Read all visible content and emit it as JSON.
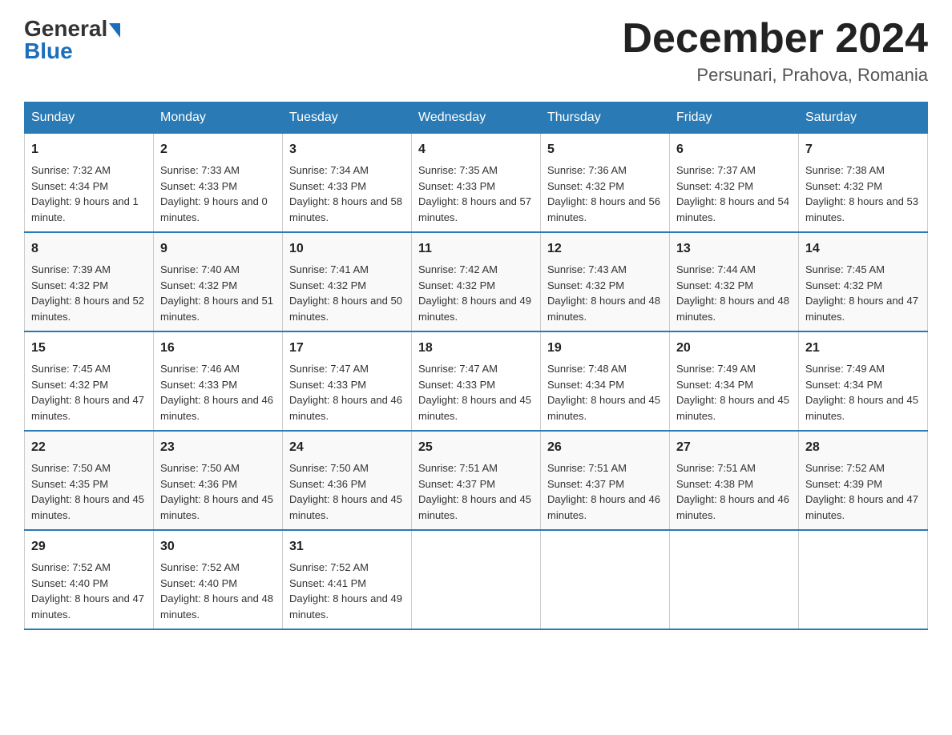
{
  "header": {
    "logo_general": "General",
    "logo_blue": "Blue",
    "month_title": "December 2024",
    "location": "Persunari, Prahova, Romania"
  },
  "days_of_week": [
    "Sunday",
    "Monday",
    "Tuesday",
    "Wednesday",
    "Thursday",
    "Friday",
    "Saturday"
  ],
  "weeks": [
    [
      {
        "day": "1",
        "sunrise": "7:32 AM",
        "sunset": "4:34 PM",
        "daylight": "9 hours and 1 minute."
      },
      {
        "day": "2",
        "sunrise": "7:33 AM",
        "sunset": "4:33 PM",
        "daylight": "9 hours and 0 minutes."
      },
      {
        "day": "3",
        "sunrise": "7:34 AM",
        "sunset": "4:33 PM",
        "daylight": "8 hours and 58 minutes."
      },
      {
        "day": "4",
        "sunrise": "7:35 AM",
        "sunset": "4:33 PM",
        "daylight": "8 hours and 57 minutes."
      },
      {
        "day": "5",
        "sunrise": "7:36 AM",
        "sunset": "4:32 PM",
        "daylight": "8 hours and 56 minutes."
      },
      {
        "day": "6",
        "sunrise": "7:37 AM",
        "sunset": "4:32 PM",
        "daylight": "8 hours and 54 minutes."
      },
      {
        "day": "7",
        "sunrise": "7:38 AM",
        "sunset": "4:32 PM",
        "daylight": "8 hours and 53 minutes."
      }
    ],
    [
      {
        "day": "8",
        "sunrise": "7:39 AM",
        "sunset": "4:32 PM",
        "daylight": "8 hours and 52 minutes."
      },
      {
        "day": "9",
        "sunrise": "7:40 AM",
        "sunset": "4:32 PM",
        "daylight": "8 hours and 51 minutes."
      },
      {
        "day": "10",
        "sunrise": "7:41 AM",
        "sunset": "4:32 PM",
        "daylight": "8 hours and 50 minutes."
      },
      {
        "day": "11",
        "sunrise": "7:42 AM",
        "sunset": "4:32 PM",
        "daylight": "8 hours and 49 minutes."
      },
      {
        "day": "12",
        "sunrise": "7:43 AM",
        "sunset": "4:32 PM",
        "daylight": "8 hours and 48 minutes."
      },
      {
        "day": "13",
        "sunrise": "7:44 AM",
        "sunset": "4:32 PM",
        "daylight": "8 hours and 48 minutes."
      },
      {
        "day": "14",
        "sunrise": "7:45 AM",
        "sunset": "4:32 PM",
        "daylight": "8 hours and 47 minutes."
      }
    ],
    [
      {
        "day": "15",
        "sunrise": "7:45 AM",
        "sunset": "4:32 PM",
        "daylight": "8 hours and 47 minutes."
      },
      {
        "day": "16",
        "sunrise": "7:46 AM",
        "sunset": "4:33 PM",
        "daylight": "8 hours and 46 minutes."
      },
      {
        "day": "17",
        "sunrise": "7:47 AM",
        "sunset": "4:33 PM",
        "daylight": "8 hours and 46 minutes."
      },
      {
        "day": "18",
        "sunrise": "7:47 AM",
        "sunset": "4:33 PM",
        "daylight": "8 hours and 45 minutes."
      },
      {
        "day": "19",
        "sunrise": "7:48 AM",
        "sunset": "4:34 PM",
        "daylight": "8 hours and 45 minutes."
      },
      {
        "day": "20",
        "sunrise": "7:49 AM",
        "sunset": "4:34 PM",
        "daylight": "8 hours and 45 minutes."
      },
      {
        "day": "21",
        "sunrise": "7:49 AM",
        "sunset": "4:34 PM",
        "daylight": "8 hours and 45 minutes."
      }
    ],
    [
      {
        "day": "22",
        "sunrise": "7:50 AM",
        "sunset": "4:35 PM",
        "daylight": "8 hours and 45 minutes."
      },
      {
        "day": "23",
        "sunrise": "7:50 AM",
        "sunset": "4:36 PM",
        "daylight": "8 hours and 45 minutes."
      },
      {
        "day": "24",
        "sunrise": "7:50 AM",
        "sunset": "4:36 PM",
        "daylight": "8 hours and 45 minutes."
      },
      {
        "day": "25",
        "sunrise": "7:51 AM",
        "sunset": "4:37 PM",
        "daylight": "8 hours and 45 minutes."
      },
      {
        "day": "26",
        "sunrise": "7:51 AM",
        "sunset": "4:37 PM",
        "daylight": "8 hours and 46 minutes."
      },
      {
        "day": "27",
        "sunrise": "7:51 AM",
        "sunset": "4:38 PM",
        "daylight": "8 hours and 46 minutes."
      },
      {
        "day": "28",
        "sunrise": "7:52 AM",
        "sunset": "4:39 PM",
        "daylight": "8 hours and 47 minutes."
      }
    ],
    [
      {
        "day": "29",
        "sunrise": "7:52 AM",
        "sunset": "4:40 PM",
        "daylight": "8 hours and 47 minutes."
      },
      {
        "day": "30",
        "sunrise": "7:52 AM",
        "sunset": "4:40 PM",
        "daylight": "8 hours and 48 minutes."
      },
      {
        "day": "31",
        "sunrise": "7:52 AM",
        "sunset": "4:41 PM",
        "daylight": "8 hours and 49 minutes."
      },
      null,
      null,
      null,
      null
    ]
  ]
}
